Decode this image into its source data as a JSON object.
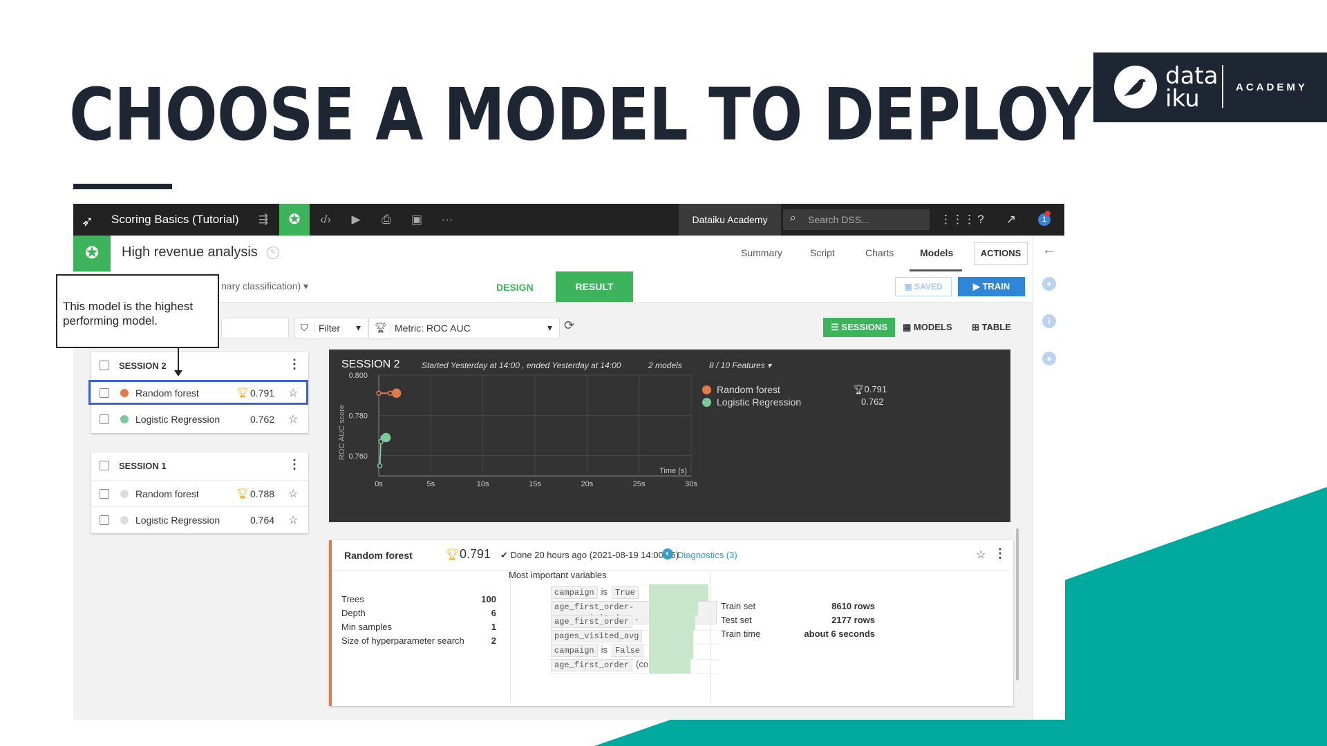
{
  "slide": {
    "title": "CHOOSE A MODEL TO DEPLOY",
    "logo": {
      "line1": "data",
      "line2": "iku",
      "academy": "ACADEMY"
    }
  },
  "colors": {
    "navy": "#1f2633",
    "teal": "#00a99d",
    "green": "#3db35c",
    "blue": "#2f86d6",
    "orange": "#e07b4a",
    "highlight": "#3a62d4"
  },
  "topbar": {
    "project": "Scoring Basics (Tutorial)",
    "instance": "Dataiku Academy",
    "search_placeholder": "Search DSS...",
    "notification_count": "1",
    "icons": [
      "flow-icon",
      "lab-icon",
      "code-icon",
      "run-icon",
      "deploy-icon",
      "dashboard-icon",
      "more-icon",
      "apps-icon",
      "help-icon",
      "trend-icon"
    ]
  },
  "analysis": {
    "title": "High revenue analysis",
    "nav": [
      "Summary",
      "Script",
      "Charts",
      "Models"
    ],
    "active_nav": "Models",
    "actions": "ACTIONS"
  },
  "toolbar": {
    "mode_partial": "nary classification)",
    "design": "DESIGN",
    "result": "RESULT",
    "saved": "SAVED",
    "train": "TRAIN",
    "filter": "Filter",
    "metric": "Metric: ROC AUC",
    "view_sessions": "SESSIONS",
    "view_models": "MODELS",
    "view_table": "TABLE"
  },
  "callout": "This model is the highest performing model.",
  "sessions": [
    {
      "name": "SESSION 2",
      "models": [
        {
          "name": "Random forest",
          "score": "0.791",
          "best": true,
          "color": "#e07b4a",
          "highlighted": true
        },
        {
          "name": "Logistic Regression",
          "score": "0.762",
          "best": false,
          "color": "#7cc99a",
          "highlighted": false
        }
      ]
    },
    {
      "name": "SESSION 1",
      "models": [
        {
          "name": "Random forest",
          "score": "0.788",
          "best": true,
          "color": "#dddddd",
          "highlighted": false
        },
        {
          "name": "Logistic Regression",
          "score": "0.764",
          "best": false,
          "color": "#dddddd",
          "highlighted": false
        }
      ]
    }
  ],
  "chart_panel": {
    "session": "SESSION 2",
    "started": "Started Yesterday at 14:00 , ended Yesterday at 14:00",
    "models_count": "2 models",
    "features": "8 / 10 Features",
    "legend": [
      {
        "name": "Random forest",
        "score": "0.791",
        "best": true,
        "color": "#e07b4a"
      },
      {
        "name": "Logistic Regression",
        "score": "0.762",
        "best": false,
        "color": "#7cc99a"
      }
    ]
  },
  "chart_data": {
    "type": "line",
    "ylabel": "ROC AUC score",
    "xlabel": "Time (s)",
    "xlim": [
      0,
      30
    ],
    "ylim": [
      0.75,
      0.8
    ],
    "x_ticks": [
      "0s",
      "5s",
      "10s",
      "15s",
      "20s",
      "25s",
      "30s"
    ],
    "y_ticks": [
      "0.800",
      "0.780",
      "0.760"
    ],
    "grid": true,
    "series": [
      {
        "name": "Random forest",
        "color": "#e07b4a",
        "points": [
          [
            0,
            0.791
          ],
          [
            1.1,
            0.791
          ],
          [
            1.7,
            0.791
          ]
        ]
      },
      {
        "name": "Logistic Regression",
        "color": "#7cc99a",
        "points": [
          [
            0.1,
            0.755
          ],
          [
            0.2,
            0.767
          ],
          [
            0.4,
            0.769
          ],
          [
            0.7,
            0.769
          ]
        ]
      }
    ]
  },
  "detail": {
    "model": "Random forest",
    "score": "0.791",
    "done": "Done 20 hours ago (2021-08-19 14:00:35)",
    "diagnostics": "Diagnostics (3)",
    "params": [
      {
        "label": "Trees",
        "value": "100"
      },
      {
        "label": "Depth",
        "value": "6"
      },
      {
        "label": "Min samples",
        "value": "1"
      },
      {
        "label": "Size of hyperparameter search",
        "value": "2"
      }
    ],
    "variables_title": "Most important variables",
    "variables": [
      {
        "parts": [
          {
            "t": "campaign",
            "tag": true
          },
          {
            "t": "is",
            "tag": false
          },
          {
            "t": "True",
            "tag": true
          }
        ],
        "importance": 1.0
      },
      {
        "parts": [
          {
            "t": "age_first_order-pages_visited_...",
            "tag": true
          }
        ],
        "importance": 0.82
      },
      {
        "parts": [
          {
            "t": "age_first_order",
            "tag": true
          }
        ],
        "importance": 0.78
      },
      {
        "parts": [
          {
            "t": "pages_visited_avg",
            "tag": true
          }
        ],
        "importance": 0.74
      },
      {
        "parts": [
          {
            "t": "campaign",
            "tag": true
          },
          {
            "t": "is",
            "tag": false
          },
          {
            "t": "False",
            "tag": true
          }
        ],
        "importance": 0.74
      },
      {
        "parts": [
          {
            "t": "age_first_order",
            "tag": true
          },
          {
            "t": "(computed)",
            "tag": false
          }
        ],
        "importance": 0.7
      }
    ],
    "train_info": [
      {
        "label": "Train set",
        "value": "8610 rows"
      },
      {
        "label": "Test set",
        "value": "2177 rows"
      },
      {
        "label": "Train time",
        "value": "about 6 seconds"
      }
    ]
  }
}
